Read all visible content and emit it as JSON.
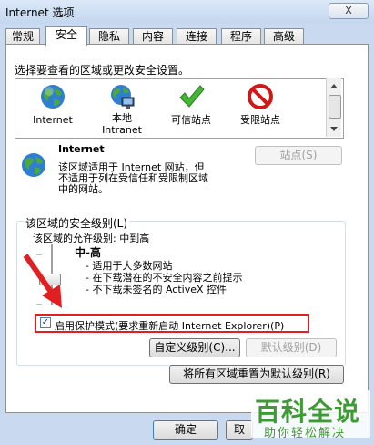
{
  "window": {
    "title": "Internet 选项",
    "close_glyph": "X"
  },
  "tabs": [
    "常规",
    "安全",
    "隐私",
    "内容",
    "连接",
    "程序",
    "高级"
  ],
  "active_tab": "安全",
  "zone_prompt": "选择要查看的区域或更改安全设置。",
  "zones": [
    {
      "label": "Internet",
      "sub": "",
      "icon": "globe-icon"
    },
    {
      "label": "本地",
      "sub": "Intranet",
      "icon": "local-intranet-icon"
    },
    {
      "label": "可信站点",
      "sub": "",
      "icon": "trusted-sites-check-icon"
    },
    {
      "label": "受限站点",
      "sub": "",
      "icon": "restricted-sites-no-icon"
    }
  ],
  "selected_zone": {
    "name": "Internet",
    "description": [
      "该区域适用于 Internet 网站，但",
      "不适用于列在受信任和受限制区域",
      "中的网站。"
    ],
    "sites_button": "站点(S)"
  },
  "security_level": {
    "group_label": "该区域的安全级别(L)",
    "allowed_levels": "该区域的允许级别: 中到高",
    "level_name": "中-高",
    "bullets": [
      "- 适用于大多数网站",
      "- 在下载潜在的不安全内容之前提示",
      "- 不下载未签名的 ActiveX 控件"
    ],
    "protected_mode_label": "启用保护模式(要求重新启动 Internet Explorer)(P)",
    "protected_mode_checked": true,
    "custom_level_button": "自定义级别(C)...",
    "default_level_button": "默认级别(D)"
  },
  "reset_all_button": "将所有区域重置为默认级别(R)",
  "footer": {
    "ok": "确定",
    "cancel": "取"
  },
  "watermark": {
    "main": "百科全说",
    "sub": "助你轻松解决"
  },
  "colors": {
    "accent_red": "#e02020",
    "watermark_green": "#3e9b33"
  }
}
